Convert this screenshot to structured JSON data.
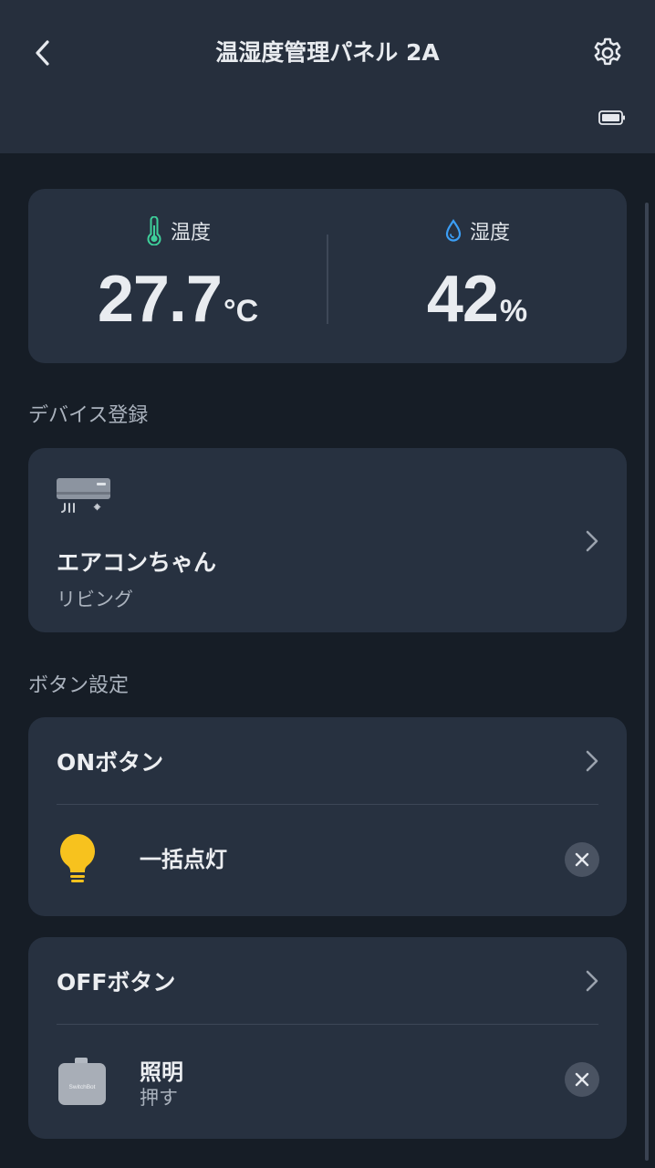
{
  "header": {
    "title": "温湿度管理パネル 2A",
    "back_icon": "chevron-left-icon",
    "settings_icon": "gear-icon",
    "battery_icon": "battery-full-icon"
  },
  "environment": {
    "temperature": {
      "label": "温度",
      "value": "27.7",
      "unit": "°C",
      "icon": "thermometer-icon",
      "icon_color": "#3ecf9a"
    },
    "humidity": {
      "label": "湿度",
      "value": "42",
      "unit": "%",
      "icon": "water-drop-icon",
      "icon_color": "#3b9ef5"
    }
  },
  "device_section": {
    "label": "デバイス登録",
    "device": {
      "name": "エアコンちゃん",
      "room": "リビング",
      "icon": "air-conditioner-icon"
    }
  },
  "button_section": {
    "label": "ボタン設定",
    "on_button": {
      "title": "ONボタン",
      "action": {
        "name": "一括点灯",
        "icon": "light-bulb-icon",
        "icon_color": "#f7c21e"
      }
    },
    "off_button": {
      "title": "OFFボタン",
      "action": {
        "name": "照明",
        "sub": "押す",
        "icon": "switchbot-bot-icon",
        "brand": "SwitchBot"
      }
    }
  }
}
